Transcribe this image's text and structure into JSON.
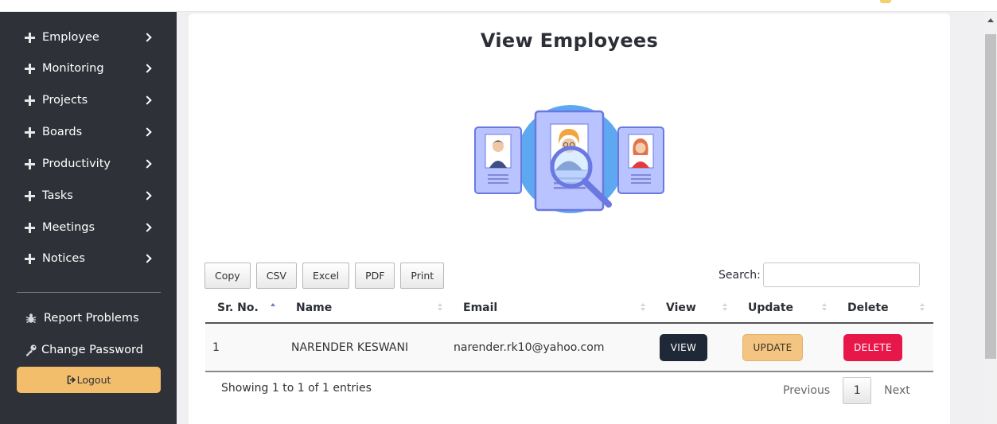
{
  "sidebar": {
    "items": [
      {
        "label": "Employee"
      },
      {
        "label": "Monitoring"
      },
      {
        "label": "Projects"
      },
      {
        "label": "Boards"
      },
      {
        "label": "Productivity"
      },
      {
        "label": "Tasks"
      },
      {
        "label": "Meetings"
      },
      {
        "label": "Notices"
      }
    ],
    "report_label": "Report Problems",
    "password_label": "Change Password",
    "logout_label": "Logout"
  },
  "main": {
    "title": "View Employees",
    "export_buttons": [
      "Copy",
      "CSV",
      "Excel",
      "PDF",
      "Print"
    ],
    "search_label": "Search:",
    "search_value": "",
    "table": {
      "columns": [
        "Sr. No.",
        "Name",
        "Email",
        "View",
        "Update",
        "Delete"
      ],
      "sorted_column": "Sr. No.",
      "rows": [
        {
          "sr": "1",
          "name": "NARENDER KESWANI",
          "email": "narender.rk10@yahoo.com",
          "view": "VIEW",
          "update": "UPDATE",
          "delete": "DELETE"
        }
      ]
    },
    "info": "Showing 1 to 1 of 1 entries",
    "pagination": {
      "previous": "Previous",
      "current": "1",
      "next": "Next"
    }
  },
  "colors": {
    "sidebar_bg": "#2e3238",
    "logout_bg": "#f3be6c",
    "view_btn": "#1f2837",
    "update_btn": "#f4c582",
    "delete_btn": "#e8174a",
    "sort_active": "#6b7bd6"
  },
  "icons": {
    "nav": "plus-icon",
    "nav_arrow": "chevron-right-icon",
    "report": "bug-icon",
    "password": "key-icon",
    "logout": "sign-out-icon"
  }
}
